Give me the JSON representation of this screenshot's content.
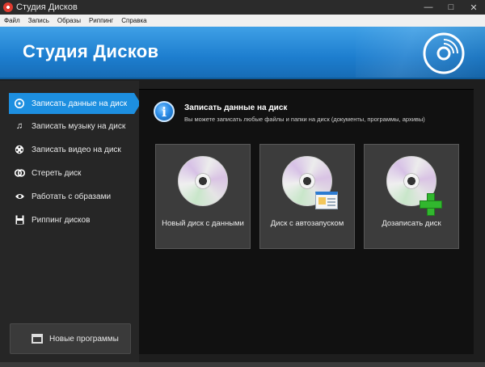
{
  "window": {
    "title": "Студия Дисков",
    "icons": {
      "app": "disc-app-icon",
      "minimize": "minimize-icon",
      "maximize": "maximize-icon",
      "close": "close-icon"
    }
  },
  "menu": {
    "items": [
      "Файл",
      "Запись",
      "Образы",
      "Риппинг",
      "Справка"
    ]
  },
  "banner": {
    "title": "Студия Дисков",
    "icon": "disc-logo-icon"
  },
  "sidebar": {
    "items": [
      {
        "label": "Записать данные на диск",
        "icon": "disc-icon",
        "active": true
      },
      {
        "label": "Записать музыку на диск",
        "icon": "music-note-icon",
        "active": false
      },
      {
        "label": "Записать видео на диск",
        "icon": "film-reel-icon",
        "active": false
      },
      {
        "label": "Стереть диск",
        "icon": "erase-disc-icon",
        "active": false
      },
      {
        "label": "Работать с образами",
        "icon": "eye-icon",
        "active": false
      },
      {
        "label": "Риппинг дисков",
        "icon": "save-icon",
        "active": false
      }
    ],
    "new_programs": {
      "label": "Новые программы",
      "icon": "box-icon"
    }
  },
  "content": {
    "title": "Записать данные на диск",
    "subtitle": "Вы можете записать любые файлы и папки на диск (документы, программы, архивы)",
    "info_icon": "info-icon",
    "tiles": [
      {
        "label": "Новый диск с данными",
        "icon": "data-disc-icon"
      },
      {
        "label": "Диск с автозапуском",
        "icon": "autorun-disc-icon"
      },
      {
        "label": "Дозаписать диск",
        "icon": "append-disc-icon"
      }
    ]
  },
  "colors": {
    "accent": "#1d8fe0",
    "banner": "#1d7ecf",
    "sidebar_bg": "#262626",
    "content_bg": "#111111",
    "tile_bg": "#3c3c3c",
    "plus_green": "#31b72e"
  }
}
